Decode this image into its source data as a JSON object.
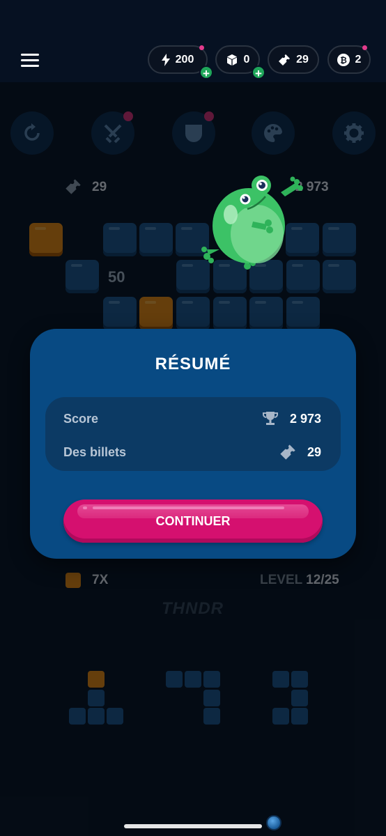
{
  "header": {
    "energy": "200",
    "boxes": "0",
    "tickets": "29",
    "coins": "2"
  },
  "board": {
    "tickets": "29",
    "score": "2 973",
    "tile_number": "50",
    "multiplier": "7X",
    "level_label": "LEVEL",
    "level_value": "12/25",
    "brand": "THNDR"
  },
  "modal": {
    "title": "RÉSUMÉ",
    "score_label": "Score",
    "score_value": "2 973",
    "tickets_label": "Des billets",
    "tickets_value": "29",
    "continue_label": "CONTINUER"
  },
  "colors": {
    "modal_bg": "#084a83",
    "button": "#d5106f",
    "accent_dot": "#e23b8c",
    "plus_green": "#1fa65a"
  },
  "icons": [
    "menu-icon",
    "bolt-icon",
    "cube-icon",
    "ticket-icon",
    "bitcoin-icon",
    "trophy-icon",
    "frog-icon"
  ]
}
